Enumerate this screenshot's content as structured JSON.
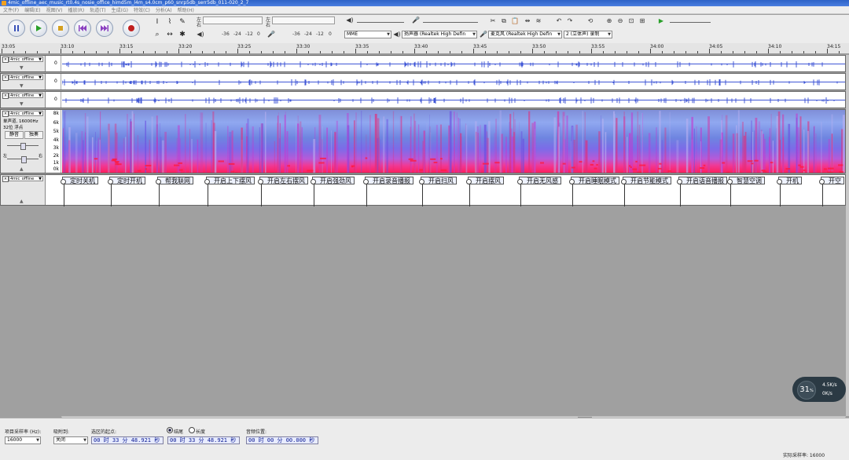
{
  "window": {
    "title": "4mic_offline_aec_music_rt0.4s_nosie_office_himd5m_l4m_s4.0cm_p60_snrp5db_serr5db_011-020_2_7"
  },
  "menu": [
    "文件(F)",
    "编辑(E)",
    "视图(V)",
    "播放(R)",
    "轨道(T)",
    "生成(G)",
    "特效(C)",
    "分析(A)",
    "帮助(H)"
  ],
  "transport": {
    "pause": "pause-button",
    "play": "play-button",
    "stop": "stop-button",
    "skip_start": "skip-start-button",
    "skip_end": "skip-end-button",
    "record": "record-button"
  },
  "meters": {
    "left_label": "左",
    "right_label": "右",
    "rec_label": "左",
    "rec_right": "右",
    "ticks": [
      "-36",
      "-24",
      "-12",
      "0"
    ]
  },
  "devices": {
    "host": "MME",
    "output": "扬声器 (Realtek High Defin",
    "input": "麦克风 (Realtek High Defin",
    "channels": "2 (立体声) 录制"
  },
  "ruler": {
    "ticks": [
      "33:05",
      "33:10",
      "33:15",
      "33:20",
      "33:25",
      "33:30",
      "33:35",
      "33:40",
      "33:45",
      "33:50",
      "33:55",
      "34:00",
      "34:05",
      "34:10",
      "34:15"
    ]
  },
  "tracks": [
    {
      "name": "4mic_offline",
      "zero": "0"
    },
    {
      "name": "4mic_offline",
      "zero": "0"
    },
    {
      "name": "4mic_offline",
      "zero": "0"
    },
    {
      "name": "4mic_offline",
      "info1": "单声道, 16000Hz",
      "info2": "32位 浮点",
      "mute": "静音",
      "solo": "独奏",
      "left": "左",
      "right": "右",
      "scale": [
        "8k",
        "6k",
        "5k",
        "4k",
        "3k",
        "2k",
        "1k",
        "0k"
      ]
    }
  ],
  "label_track": {
    "name": "4mic_offline",
    "labels": [
      "定时关机",
      "定时开机",
      "帮我联网",
      "开启上下摆风",
      "开启左右摆风",
      "开启强劲风",
      "开启录音播报",
      "开启扫风",
      "开启摆风",
      "开启无风感",
      "开启睡眠模式",
      "开启节能模式",
      "开启语音播报",
      "智慧空调",
      "开机",
      "开空"
    ]
  },
  "bottom": {
    "rate_label": "项目采样率 (Hz):",
    "rate_value": "16000",
    "snap_label": "吸附到:",
    "snap_value": "关闭",
    "sel_start_label": "选区的起点:",
    "sel_start": "00 时 33 分 48.921 秒",
    "end_label": "结尾",
    "length_label": "长度",
    "sel_end": "00 时 33 分 48.921 秒",
    "pos_label": "音频位置:",
    "pos": "00 时 00 分 00.000 秒",
    "actual_rate": "实际采样率: 16000"
  },
  "widget": {
    "percent": "31",
    "speed_up": "4.5K/s",
    "speed_down": "0K/s"
  }
}
